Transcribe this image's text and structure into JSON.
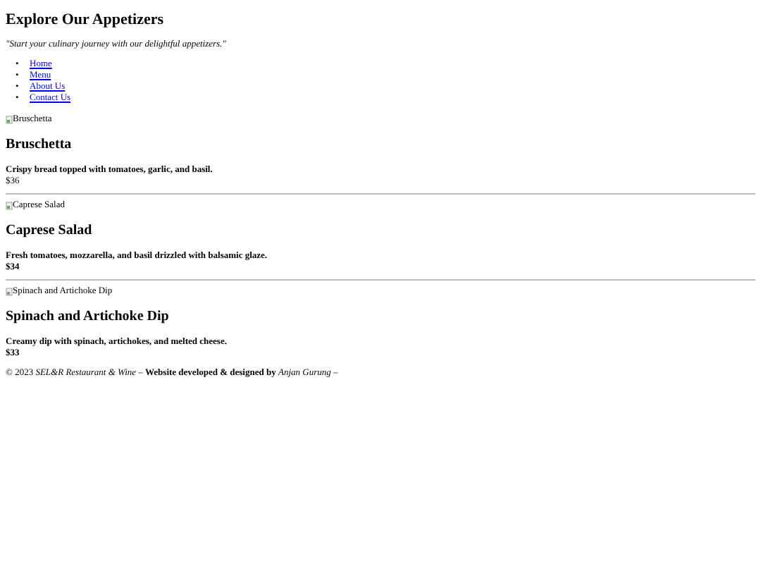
{
  "title": "Explore Our Appetizers",
  "tagline": "\"Start your culinary journey with our delightful appetizers.\"",
  "nav": [
    {
      "marker": "•",
      "label": "Home"
    },
    {
      "marker": "•",
      "label": "Menu"
    },
    {
      "marker": "•",
      "label": "About Us"
    },
    {
      "marker": "•",
      "label": "Contact Us"
    }
  ],
  "items": [
    {
      "image_alt": "Bruschetta",
      "name": "Bruschetta",
      "description": "Crispy bread topped with tomatoes, garlic, and basil.",
      "price": "$36",
      "price_bold": false
    },
    {
      "image_alt": "Caprese Salad",
      "name": "Caprese Salad",
      "description": "Fresh tomatoes, mozzarella, and basil drizzled with balsamic glaze.",
      "price": "$34",
      "price_bold": true
    },
    {
      "image_alt": "Spinach and Artichoke Dip",
      "name": "Spinach and Artichoke Dip",
      "description": "Creamy dip with spinach, artichokes, and melted cheese.",
      "price": "$33",
      "price_bold": true
    }
  ],
  "footer": "© 2023 *SEL&R Restaurant & Wine* – **Website developed & designed by** *Anjan Gurung* –"
}
